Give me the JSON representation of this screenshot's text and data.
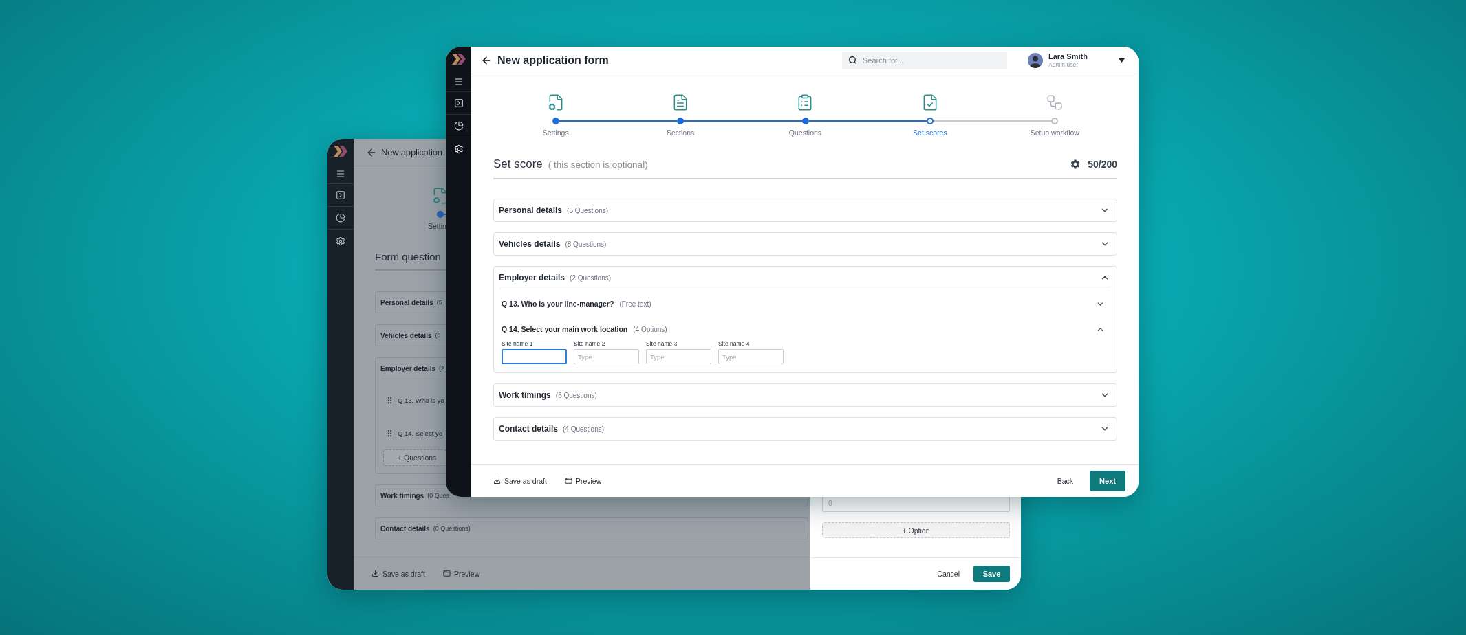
{
  "back_window": {
    "title": "New application",
    "step_label": "Settin",
    "heading": "Form question",
    "sections": [
      {
        "title": "Personal details",
        "count": "(5"
      },
      {
        "title": "Vehicles details",
        "count": "(8"
      },
      {
        "title": "Employer details",
        "count": "(2",
        "questions": [
          {
            "text": "Q 13. Who is yo"
          },
          {
            "text": "Q 14. Select yo"
          }
        ],
        "add_label": "+ Questions"
      },
      {
        "title": "Work timings",
        "count": "(0 Ques"
      },
      {
        "title": "Contact details",
        "count": "(0 Questions)"
      }
    ],
    "footer": [
      {
        "kind": "draft",
        "label": "Save as draft"
      },
      {
        "kind": "preview",
        "label": "Preview"
      }
    ],
    "drawer": {
      "input_placeholder": "0",
      "add_option": "+ Option",
      "cancel": "Cancel",
      "save": "Save"
    }
  },
  "front_window": {
    "title": "New application form",
    "search": {
      "placeholder": "Search for..."
    },
    "user": {
      "name": "Lara Smith",
      "role": "Admin user"
    },
    "steps": [
      {
        "label": "Settings",
        "done": true,
        "selected": false
      },
      {
        "label": "Sections",
        "done": true,
        "selected": false
      },
      {
        "label": "Questions",
        "done": true,
        "selected": false
      },
      {
        "label": "Set scores",
        "done": false,
        "selected": true
      },
      {
        "label": "Setup workflow",
        "done": false,
        "selected": false
      }
    ],
    "score": {
      "title": "Set score",
      "note": "( this section is optional)",
      "value": "50/200"
    },
    "sections": [
      {
        "title": "Personal details",
        "count": "(5 Questions)",
        "expanded": false
      },
      {
        "title": "Vehicles details",
        "count": "(8 Questions)",
        "expanded": false
      },
      {
        "title": "Employer details",
        "count": "(2 Questions)",
        "expanded": true,
        "questions": [
          {
            "text": "Q 13. Who is your line-manager?",
            "type": "(Free text)",
            "expanded": false
          },
          {
            "text": "Q 14. Select your main work location",
            "type": "(4 Options)",
            "expanded": true,
            "fields": [
              {
                "label": "Site name 1",
                "focused": true
              },
              {
                "label": "Site name 2",
                "placeholder": "Type",
                "focused": false
              },
              {
                "label": "Site name 3",
                "placeholder": "Type",
                "focused": false
              },
              {
                "label": "Site name 4",
                "placeholder": "Type",
                "focused": false
              }
            ]
          }
        ]
      },
      {
        "title": "Work timings",
        "count": "(6 Questions)",
        "expanded": false
      },
      {
        "title": "Contact details",
        "count": "(4 Questions)",
        "expanded": false
      }
    ],
    "footer": {
      "actions": [
        {
          "kind": "draft",
          "label": "Save as draft"
        },
        {
          "kind": "preview",
          "label": "Preview"
        }
      ],
      "back": "Back",
      "next": "Next"
    }
  }
}
